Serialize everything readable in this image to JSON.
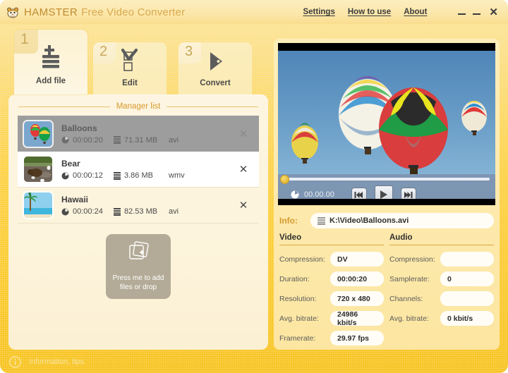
{
  "app": {
    "brand_strong": "HAMSTER",
    "brand_rest": "Free Video Converter",
    "logo_icon": "hamster-logo-icon"
  },
  "menu": {
    "items": [
      {
        "label": "Settings",
        "name": "menu-settings"
      },
      {
        "label": "How to use",
        "name": "menu-how-to-use"
      },
      {
        "label": "About",
        "name": "menu-about"
      }
    ],
    "window_controls": [
      {
        "label": "–",
        "name": "minimize-button"
      },
      {
        "label": "–",
        "name": "maximize-button"
      },
      {
        "label": "✕",
        "name": "close-button"
      }
    ]
  },
  "tabs": [
    {
      "number": "1",
      "label": "Add file",
      "icon": "add-file-icon",
      "active": true
    },
    {
      "number": "2",
      "label": "Edit",
      "icon": "edit-check-icon",
      "active": false
    },
    {
      "number": "3",
      "label": "Convert",
      "icon": "convert-play-icon",
      "active": false
    }
  ],
  "manager": {
    "title": "Manager list",
    "items": [
      {
        "name": "Balloons",
        "duration": "00:00:20",
        "size": "71.31 MB",
        "format": "avi",
        "thumb": "balloons-thumbnail",
        "selected": true,
        "close_label": "✕"
      },
      {
        "name": "Bear",
        "duration": "00:00:12",
        "size": "3.86 MB",
        "format": "wmv",
        "thumb": "bear-thumbnail",
        "selected": false,
        "close_label": "✕"
      },
      {
        "name": "Hawaii",
        "duration": "00:00:24",
        "size": "82.53 MB",
        "format": "avi",
        "thumb": "hawaii-thumbnail",
        "selected": false,
        "close_label": "✕"
      }
    ],
    "drop_text_line1": "Press me to add",
    "drop_text_line2": "files or drop",
    "drop_icon": "add-files-stack-icon"
  },
  "player": {
    "preview_alt": "hot-air-balloons-preview",
    "time": "00.00.00",
    "buttons": [
      {
        "name": "previous-frame-button",
        "glyph": "prev-icon"
      },
      {
        "name": "play-button",
        "glyph": "play-icon"
      },
      {
        "name": "next-frame-button",
        "glyph": "next-icon"
      }
    ]
  },
  "info": {
    "label": "Info:",
    "path": "K:\\Video\\Balloons.avi",
    "path_icon": "file-list-icon",
    "video": {
      "header": "Video",
      "fields": [
        {
          "label": "Compression:",
          "value": "DV"
        },
        {
          "label": "Duration:",
          "value": "00:00:20"
        },
        {
          "label": "Resolution:",
          "value": "720 x 480"
        },
        {
          "label": "Avg. bitrate:",
          "value": "24986 kbit/s"
        },
        {
          "label": "Framerate:",
          "value": "29.97 fps"
        }
      ]
    },
    "audio": {
      "header": "Audio",
      "fields": [
        {
          "label": "Compression:",
          "value": ""
        },
        {
          "label": "Samplerate:",
          "value": "0"
        },
        {
          "label": "Channels:",
          "value": ""
        },
        {
          "label": "Avg. bitrate:",
          "value": "0 kbit/s"
        }
      ]
    }
  },
  "status": {
    "icon": "information-icon",
    "text": "Information, tips"
  },
  "colors": {
    "window_bg_top": "#fbe49b",
    "window_bg_bottom": "#f7c31f",
    "accent_orange": "#d79a2d",
    "panel_cream": "#fdf5e1",
    "panel_right": "#fdeeb9",
    "selected_row": "#9d9d9d",
    "drop_zone": "#b3ab97"
  }
}
